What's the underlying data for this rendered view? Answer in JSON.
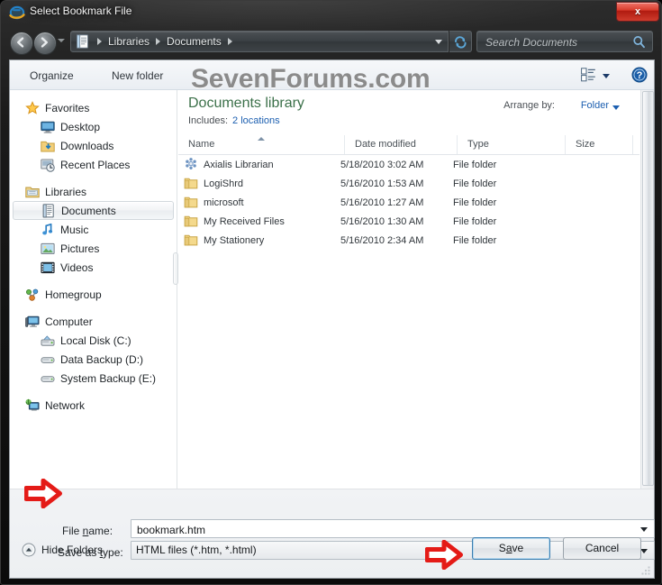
{
  "window": {
    "title": "Select Bookmark File",
    "title_icon": "internet-explorer-icon",
    "close_label": "x"
  },
  "navbar": {
    "back_icon": "back-arrow-icon",
    "forward_icon": "forward-arrow-icon",
    "recent_pages_icon": "chevron-down-icon",
    "breadcrumb_icon": "documents-library-icon",
    "breadcrumbs": [
      "Libraries",
      "Documents"
    ],
    "address_dropdown_icon": "chevron-down-icon",
    "refresh_icon": "refresh-icon",
    "search": {
      "placeholder": "Search Documents",
      "value": "",
      "icon": "search-icon"
    }
  },
  "toolbar": {
    "organize_label": "Organize",
    "new_folder_label": "New folder",
    "views_icon": "view-list-icon",
    "views_caret_icon": "chevron-down-icon",
    "help_icon": "help-icon"
  },
  "watermark": "SevenForums.com",
  "sidebar": {
    "groups": [
      {
        "header": {
          "label": "Favorites",
          "icon": "star-icon"
        },
        "items": [
          {
            "label": "Desktop",
            "icon": "desktop-icon"
          },
          {
            "label": "Downloads",
            "icon": "downloads-folder-icon"
          },
          {
            "label": "Recent Places",
            "icon": "recent-places-icon"
          }
        ]
      },
      {
        "header": {
          "label": "Libraries",
          "icon": "libraries-icon"
        },
        "items": [
          {
            "label": "Documents",
            "icon": "documents-library-icon",
            "selected": true
          },
          {
            "label": "Music",
            "icon": "music-library-icon"
          },
          {
            "label": "Pictures",
            "icon": "pictures-library-icon"
          },
          {
            "label": "Videos",
            "icon": "videos-library-icon"
          }
        ]
      },
      {
        "header": {
          "label": "Homegroup",
          "icon": "homegroup-icon"
        },
        "items": []
      },
      {
        "header": {
          "label": "Computer",
          "icon": "computer-icon"
        },
        "items": [
          {
            "label": "Local Disk (C:)",
            "icon": "local-disk-icon"
          },
          {
            "label": "Data Backup (D:)",
            "icon": "drive-icon"
          },
          {
            "label": "System Backup (E:)",
            "icon": "drive-icon"
          }
        ]
      },
      {
        "header": {
          "label": "Network",
          "icon": "network-icon"
        },
        "items": []
      }
    ]
  },
  "library": {
    "title": "Documents library",
    "includes_label": "Includes:",
    "includes_value": "2 locations",
    "arrange_label": "Arrange by:",
    "arrange_value": "Folder",
    "arrange_caret_icon": "chevron-down-icon"
  },
  "filelist": {
    "columns": [
      {
        "label": "Name",
        "sorted": true,
        "sort_icon": "sort-ascending-icon"
      },
      {
        "label": "Date modified"
      },
      {
        "label": "Type"
      },
      {
        "label": "Size"
      }
    ],
    "rows": [
      {
        "name": "Axialis Librarian",
        "date": "5/18/2010 3:02 AM",
        "type": "File folder",
        "size": "",
        "icon": "axialis-folder-icon"
      },
      {
        "name": "LogiShrd",
        "date": "5/16/2010 1:53 AM",
        "type": "File folder",
        "size": "",
        "icon": "folder-icon"
      },
      {
        "name": "microsoft",
        "date": "5/16/2010 1:27 AM",
        "type": "File folder",
        "size": "",
        "icon": "folder-icon"
      },
      {
        "name": "My Received Files",
        "date": "5/16/2010 1:30 AM",
        "type": "File folder",
        "size": "",
        "icon": "folder-icon"
      },
      {
        "name": "My Stationery",
        "date": "5/16/2010 2:34 AM",
        "type": "File folder",
        "size": "",
        "icon": "folder-icon"
      }
    ]
  },
  "footer": {
    "filename_label_pre": "File ",
    "filename_label_accel": "n",
    "filename_label_post": "ame:",
    "filename_value": "bookmark.htm",
    "filename_caret_icon": "chevron-down-icon",
    "filetype_label_pre": "Save as ",
    "filetype_label_accel": "t",
    "filetype_label_post": "ype:",
    "filetype_value": "HTML files (*.htm, *.html)",
    "filetype_caret_icon": "chevron-down-icon",
    "hide_folders_label": "Hide Folders",
    "hide_folders_icon": "collapse-up-icon",
    "save_label_pre": "S",
    "save_label_accel": "a",
    "save_label_post": "ve",
    "cancel_label": "Cancel"
  },
  "annotations": {
    "arrow_color": "#e41b17",
    "arrow_fill": "#ffffff",
    "arrows": [
      {
        "name": "filename-callout-arrow"
      },
      {
        "name": "save-button-callout-arrow"
      }
    ]
  }
}
